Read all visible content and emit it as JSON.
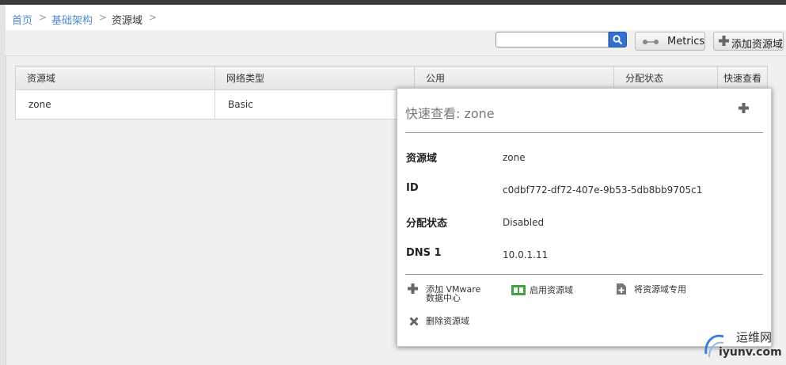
{
  "breadcrumb": {
    "items": [
      "首页",
      "基础架构",
      "资源域"
    ],
    "separator": ">"
  },
  "toolbar": {
    "search": {
      "value": "",
      "placeholder": ""
    },
    "search_icon": "search-icon",
    "metrics_label": "Metrics",
    "metrics_icon": "metrics-icon",
    "add_label": "添加资源域",
    "add_icon": "plus-icon"
  },
  "table": {
    "columns": [
      "资源域",
      "网络类型",
      "公用",
      "分配状态",
      "快速查看"
    ],
    "rows": [
      {
        "name": "zone",
        "network_type": "Basic"
      }
    ]
  },
  "quickview": {
    "title": "快速查看: zone",
    "expand_icon": "plus-icon",
    "fields": [
      {
        "label": "资源域",
        "value": "zone"
      },
      {
        "label": "ID",
        "value": "c0dbf772-df72-407e-9b53-5db8bb9705c1"
      },
      {
        "label": "分配状态",
        "value": "Disabled"
      },
      {
        "label": "DNS 1",
        "value": "10.0.1.11"
      }
    ],
    "actions": {
      "add_vmware": {
        "line1": "添加 VMware",
        "line2": "数据中心",
        "icon": "plus-icon"
      },
      "enable_zone": {
        "label": "启用资源域",
        "icon": "enable-icon"
      },
      "dedicate_zone": {
        "label": "将资源域专用",
        "icon": "dedicate-icon"
      },
      "delete_zone": {
        "label": "删除资源域",
        "icon": "delete-x-icon"
      }
    }
  },
  "watermark": {
    "text": "运维网",
    "url_text": "iyunv.com"
  },
  "colors": {
    "link": "#4f8ad0",
    "search_button": "#2f6fd0",
    "enable_icon": "#3fa33f"
  }
}
